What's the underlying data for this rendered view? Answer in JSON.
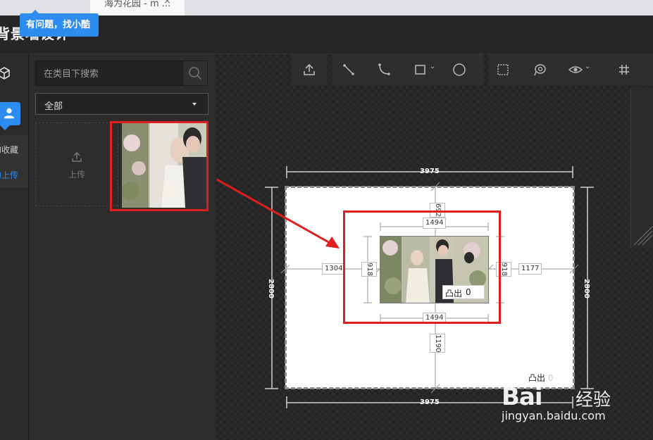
{
  "browser": {
    "tab_title": "海为花园 -  m ...",
    "close_glyph": "×"
  },
  "header": {
    "app_title": "背景墙设计",
    "help_tooltip": "有问题，找小酷"
  },
  "left_rail": {
    "items": [
      {
        "icon": "cube-icon",
        "label": ""
      },
      {
        "icon": "user-icon",
        "label": "",
        "active": true
      }
    ],
    "sub_items": [
      {
        "label": "的收藏"
      },
      {
        "label": "的上传",
        "active": true
      }
    ],
    "accent_color": "#2d8cf0"
  },
  "library": {
    "search_placeholder": "在类目下搜索",
    "category_selected": "全部",
    "upload_label": "上传"
  },
  "toolbar": {
    "buttons": [
      {
        "icon": "upload-icon"
      },
      {
        "icon": "line-tool-icon"
      },
      {
        "icon": "arc-tool-icon"
      },
      {
        "icon": "rectangle-tool-icon",
        "has_dropdown": true
      },
      {
        "icon": "circle-tool-icon"
      },
      {
        "icon": "frame-select-icon"
      },
      {
        "icon": "lasso-icon"
      },
      {
        "icon": "eye-icon",
        "has_dropdown": true
      },
      {
        "icon": "grid-hash-icon"
      }
    ]
  },
  "wall": {
    "width": "3975",
    "height": "2800",
    "left_gap": "1304",
    "right_gap": "1177",
    "top_gap": "692",
    "bottom_gap": "1190",
    "emboss_label": "凸出",
    "emboss_value": "0"
  },
  "artwork": {
    "width": "1494",
    "height": "918",
    "emboss_label": "凸出",
    "emboss_value": "0"
  },
  "highlight_color": "#e01e1e",
  "watermark": {
    "logo": "Bai",
    "brand": "经验",
    "url": "jingyan.baidu.com"
  }
}
